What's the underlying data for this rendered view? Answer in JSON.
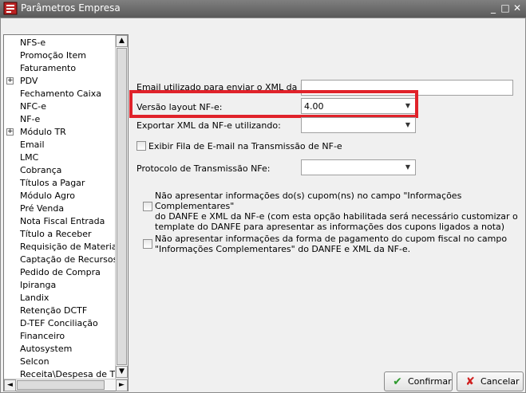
{
  "window": {
    "title": "Parâmetros Empresa",
    "controls": {
      "minimize": "_",
      "maximize": "□",
      "close": "✕"
    }
  },
  "tree": {
    "items": [
      {
        "label": "NFS-e",
        "expandable": false
      },
      {
        "label": "Promoção Item",
        "expandable": false
      },
      {
        "label": "Faturamento",
        "expandable": false
      },
      {
        "label": "PDV",
        "expandable": true
      },
      {
        "label": "Fechamento Caixa",
        "expandable": false
      },
      {
        "label": "NFC-e",
        "expandable": false
      },
      {
        "label": "NF-e",
        "expandable": false
      },
      {
        "label": "Módulo TR",
        "expandable": true
      },
      {
        "label": "Email",
        "expandable": false
      },
      {
        "label": "LMC",
        "expandable": false
      },
      {
        "label": "Cobrança",
        "expandable": false
      },
      {
        "label": "Títulos a Pagar",
        "expandable": false
      },
      {
        "label": "Módulo Agro",
        "expandable": false
      },
      {
        "label": "Pré Venda",
        "expandable": false
      },
      {
        "label": "Nota Fiscal Entrada",
        "expandable": false
      },
      {
        "label": "Título a Receber",
        "expandable": false
      },
      {
        "label": "Requisição de Materiais",
        "expandable": false
      },
      {
        "label": "Captação de Recursos",
        "expandable": false
      },
      {
        "label": "Pedido de Compra",
        "expandable": false
      },
      {
        "label": "Ipiranga",
        "expandable": false
      },
      {
        "label": "Landix",
        "expandable": false
      },
      {
        "label": "Retenção DCTF",
        "expandable": false
      },
      {
        "label": "D-TEF Conciliação",
        "expandable": false
      },
      {
        "label": "Financeiro",
        "expandable": false
      },
      {
        "label": "Autosystem",
        "expandable": false
      },
      {
        "label": "Selcon",
        "expandable": false
      },
      {
        "label": "Receita\\Despesa de Titul",
        "expandable": false
      }
    ],
    "expander_symbol": "+",
    "scroll_up": "▲",
    "scroll_down": "▼",
    "scroll_left": "◄",
    "scroll_right": "►"
  },
  "form": {
    "email_label": "Email utilizado para enviar o XML da NF-e:",
    "email_value": "",
    "layout_label": "Versão layout NF-e:",
    "layout_value": "4.00",
    "export_label": "Exportar XML da NF-e utilizando:",
    "export_value": "",
    "fila_label": "Exibir Fila de E-mail na Transmissão de NF-e",
    "fila_checked": false,
    "protocolo_label": "Protocolo de Transmissão NFe:",
    "protocolo_value": "",
    "cupom_lines": [
      "Não apresentar informações do(s) cupom(ns) no campo \"Informações Complementares\"",
      "do DANFE e XML da NF-e (com esta opção habilitada será necessário customizar o",
      "template do DANFE para apresentar as informações dos cupons ligados a nota)"
    ],
    "cupom_checked": false,
    "pagamento_lines": [
      "Não apresentar informações da forma de pagamento do cupom fiscal no campo",
      "\"Informações Complementares\" do DANFE e XML da NF-e."
    ],
    "pagamento_checked": false,
    "dropdown_arrow": "▼"
  },
  "buttons": {
    "confirm_label": "Confirmar",
    "confirm_icon": "check-icon",
    "cancel_label": "Cancelar",
    "cancel_icon": "x-icon"
  },
  "colors": {
    "highlight": "#e0222a",
    "confirm_icon": "#2e9a2e",
    "cancel_icon": "#d02020"
  }
}
